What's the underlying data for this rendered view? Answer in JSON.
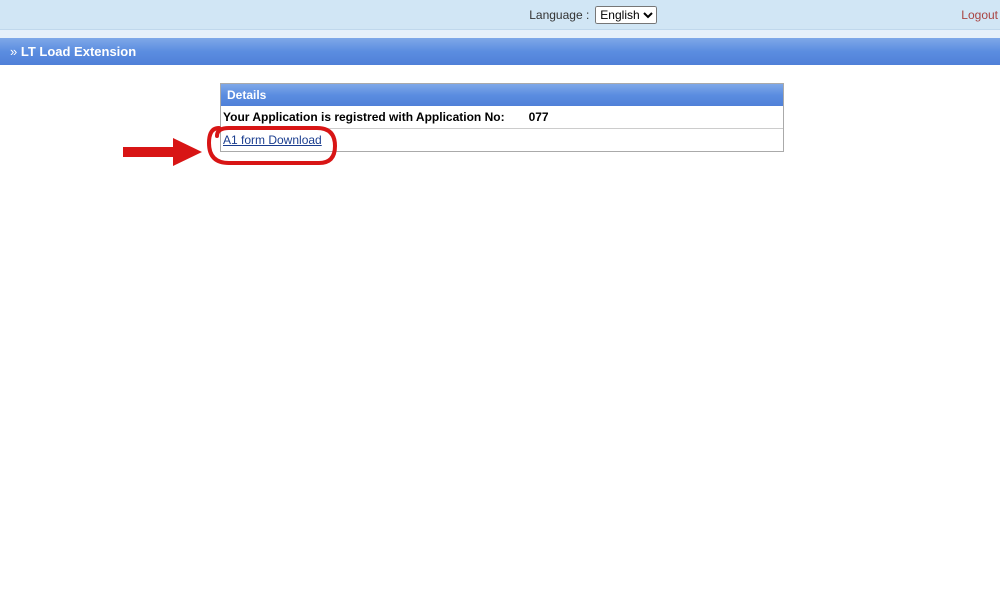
{
  "topBar": {
    "languageLabel": "Language",
    "languageSelected": "English",
    "languageOptions": [
      "English"
    ],
    "logoutLabel": "Logout"
  },
  "pageHeader": {
    "title": "LT Load Extension"
  },
  "detailsPanel": {
    "header": "Details",
    "applicationLabel": "Your Application is registred with Application No:",
    "applicationNo": "077",
    "downloadLinkText": "A1 form Download"
  }
}
